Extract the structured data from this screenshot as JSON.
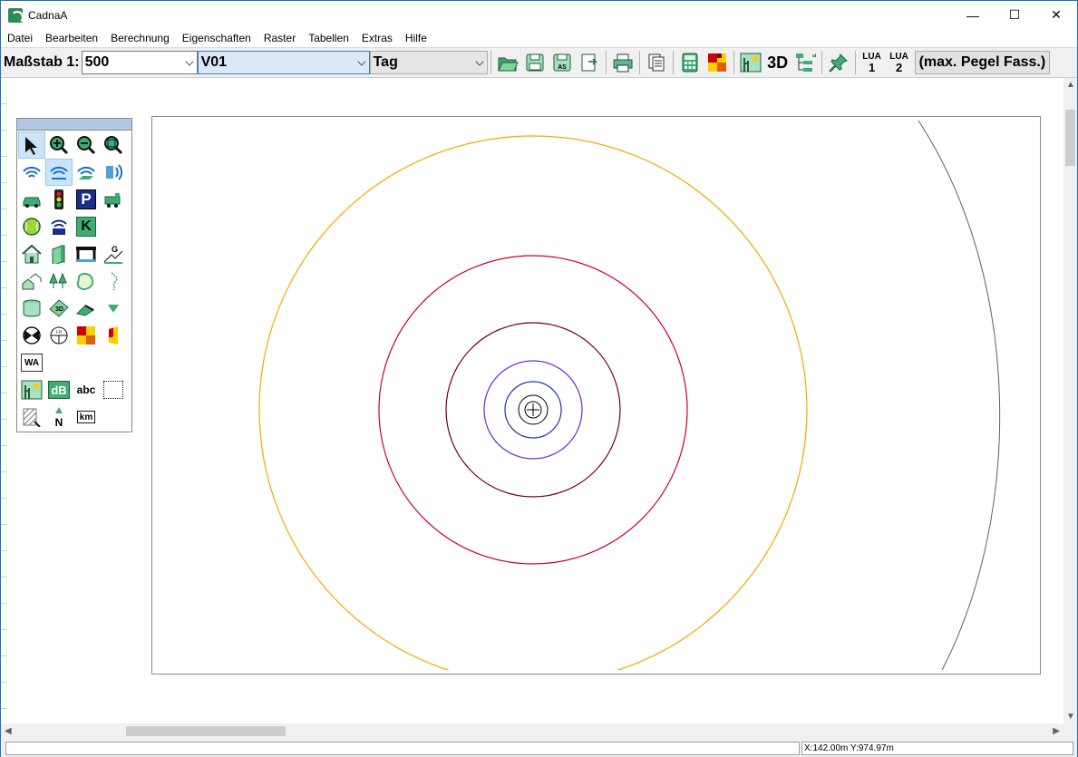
{
  "window": {
    "title": "CadnaA",
    "minimize_glyph": "—",
    "maximize_glyph": "☐",
    "close_glyph": "✕"
  },
  "menu": [
    "Datei",
    "Bearbeiten",
    "Berechnung",
    "Eigenschaften",
    "Raster",
    "Tabellen",
    "Extras",
    "Hilfe"
  ],
  "toolbar": {
    "scale_label": "Maßstab 1:",
    "scale_value": "500",
    "variant_value": "V01",
    "period_value": "Tag",
    "btn_3d": "3D",
    "lua1_top": "LUA",
    "lua1_num": "1",
    "lua2_top": "LUA",
    "lua2_num": "2",
    "display_mode": "(max. Pegel Fass.)",
    "icons": [
      "open-folder-icon",
      "save-icon",
      "save-as-icon",
      "export-icon",
      "print-icon",
      "copy-document-icon",
      "calculator-icon",
      "grid-map-icon",
      "object-palette-icon",
      "pin-icon"
    ]
  },
  "palette": {
    "abc_label": "abc",
    "wa_label": "WA",
    "db_label": "dB",
    "k_label": "K",
    "p_label": "P",
    "km_label": "km",
    "n_label": "N",
    "g_label": "G",
    "three_d_label": "3D"
  },
  "colors": {
    "contour_outer": "#f2a900",
    "contour_red": "#cc0022",
    "contour_darkred": "#6b0010",
    "contour_purple": "#6a2ad4",
    "contour_blue": "#2233aa",
    "contour_inner": "#000000",
    "far_arc": "#606060"
  },
  "status": {
    "coordinates": "X:142.00m Y:974.97m"
  }
}
